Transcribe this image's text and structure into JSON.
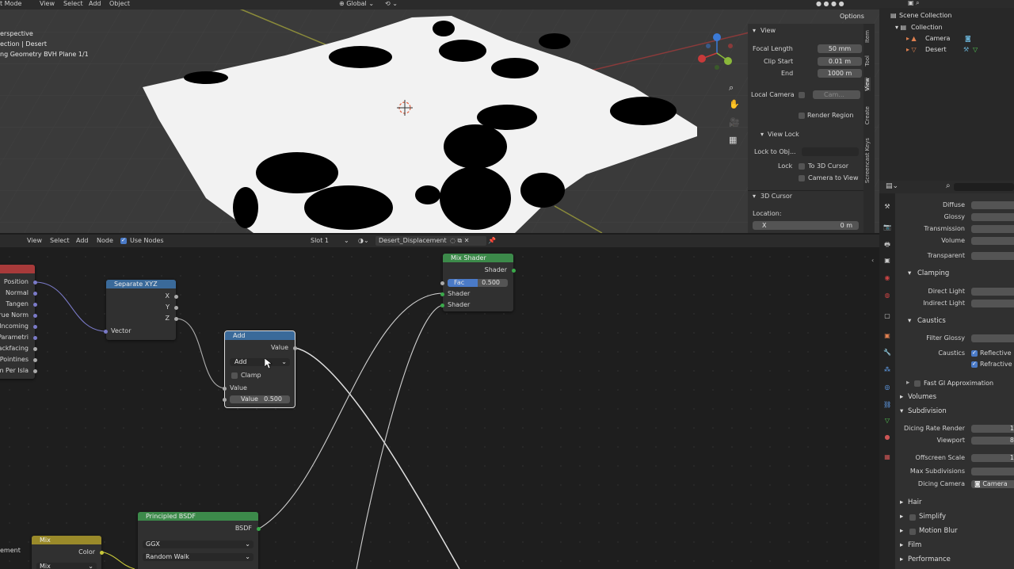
{
  "viewport": {
    "menu": [
      "t Mode",
      "View",
      "Select",
      "Add",
      "Object"
    ],
    "transform": "Global",
    "options": "Options",
    "overlay_lines": [
      "erspective",
      "ection | Desert",
      "ng Geometry BVH Plane 1/1"
    ]
  },
  "npanel": {
    "view_header": "View",
    "focal_length_label": "Focal Length",
    "focal_length": "50 mm",
    "clip_start_label": "Clip Start",
    "clip_start": "0.01 m",
    "end_label": "End",
    "end": "1000 m",
    "local_camera_label": "Local Camera",
    "local_camera_value": "Cam...",
    "render_region": "Render Region",
    "view_lock_header": "View Lock",
    "lock_to_obj_label": "Lock to Obj...",
    "lock_label": "Lock",
    "to_3d_cursor": "To 3D Cursor",
    "camera_to_view": "Camera to View",
    "cursor_header": "3D Cursor",
    "location_label": "Location:",
    "x_label": "X",
    "x_value": "0 m",
    "tabs": [
      "Item",
      "Tool",
      "View",
      "Create",
      "Screencast Keys"
    ]
  },
  "outliner": {
    "scene_collection": "Scene Collection",
    "collection": "Collection",
    "camera": "Camera",
    "desert": "Desert"
  },
  "properties": {
    "light_paths": [
      "Diffuse",
      "Glossy",
      "Transmission",
      "Volume",
      "Transparent"
    ],
    "clamping": "Clamping",
    "direct_light": "Direct Light",
    "indirect_light": "Indirect Light",
    "caustics_header": "Caustics",
    "filter_glossy": "Filter Glossy",
    "caustics_label": "Caustics",
    "reflective": "Reflective",
    "refractive": "Refractive",
    "fast_gi": "Fast GI Approximation",
    "volumes": "Volumes",
    "subdivision": "Subdivision",
    "dicing_rate_render": "Dicing Rate Render",
    "dicing_rate_render_value": "1",
    "viewport": "Viewport",
    "viewport_value": "8",
    "offscreen_scale": "Offscreen Scale",
    "offscreen_scale_value": "1",
    "max_subdivisions": "Max Subdivisions",
    "dicing_camera": "Dicing Camera",
    "dicing_camera_value": "Camera",
    "hair": "Hair",
    "simplify": "Simplify",
    "motion_blur": "Motion Blur",
    "film": "Film",
    "performance": "Performance"
  },
  "node_editor": {
    "menu": [
      "View",
      "Select",
      "Add",
      "Node"
    ],
    "use_nodes": "Use Nodes",
    "slot": "Slot 1",
    "material": "Desert_Displacement",
    "texcoord_outputs": [
      "Position",
      "Normal",
      "Tangen",
      "rue Norm",
      "Incoming",
      "Parametri",
      "Backfacing",
      "Pointines",
      "m Per Isla"
    ],
    "separate_xyz": {
      "title": "Separate XYZ",
      "x": "X",
      "y": "Y",
      "z": "Z",
      "vector": "Vector"
    },
    "math": {
      "title": "Add",
      "output": "Value",
      "operation": "Add",
      "clamp": "Clamp",
      "input": "Value",
      "value_label": "Value",
      "value": "0.500"
    },
    "mix_shader": {
      "title": "Mix Shader",
      "output": "Shader",
      "fac_label": "Fac",
      "fac": "0.500",
      "shader1": "Shader",
      "shader2": "Shader"
    },
    "principled": {
      "title": "Principled BSDF",
      "output": "BSDF",
      "distribution": "GGX",
      "subsurface": "Random Walk"
    },
    "mix": {
      "title": "Mix",
      "output": "Color",
      "mode": "Mix"
    },
    "left_label": "ement"
  },
  "colors": {
    "accent_blue": "#4a7ac7",
    "node_header_green": "#3c8a4a",
    "node_header_blue": "#3a6a9a",
    "node_header_yellow": "#9a8a2a",
    "node_header_red": "#a83a3a"
  }
}
